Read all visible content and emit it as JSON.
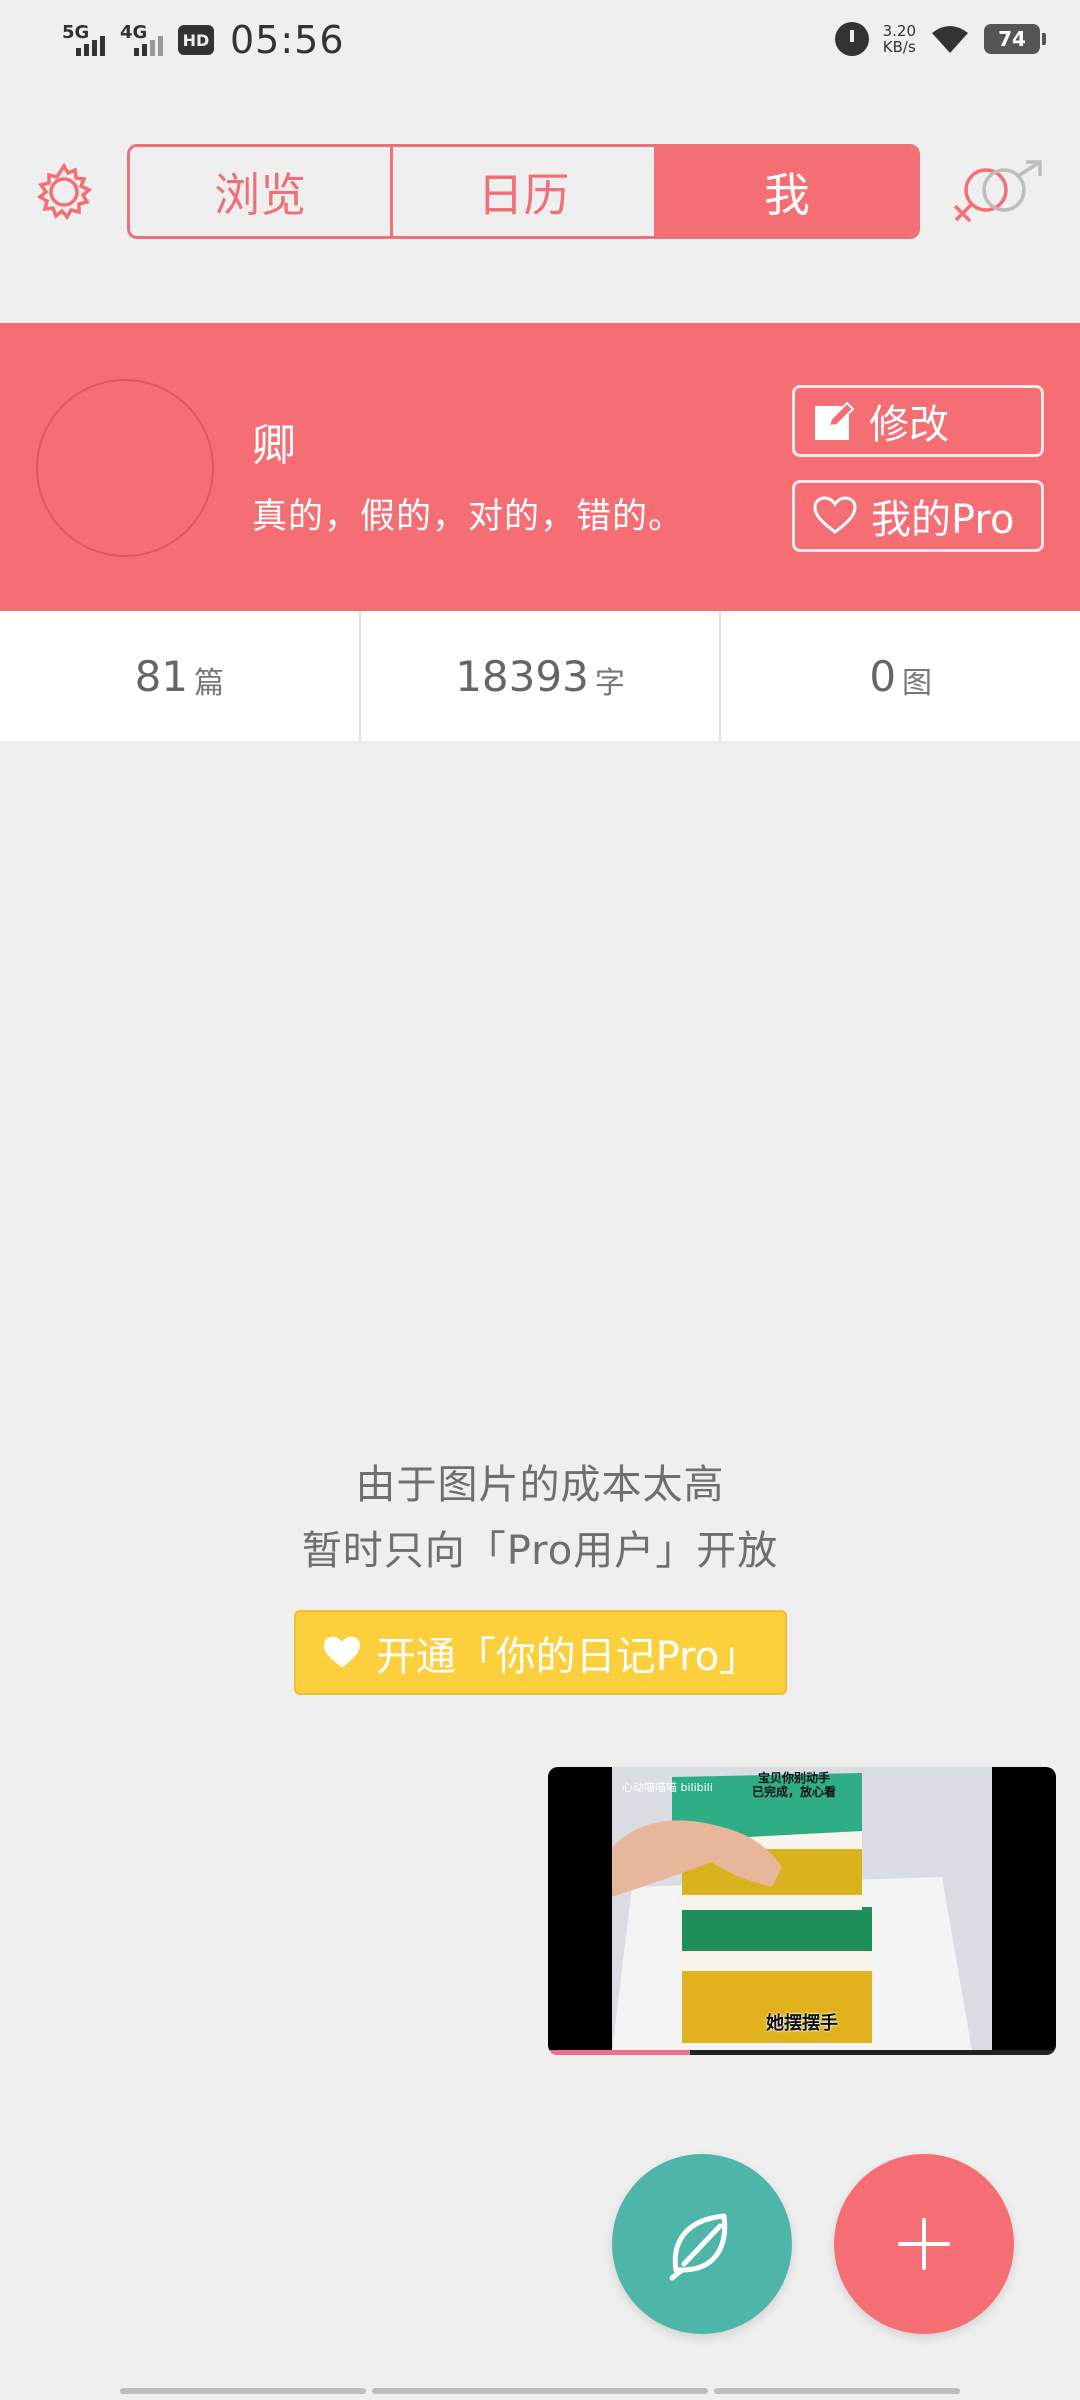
{
  "status_bar": {
    "network_1": "5G",
    "network_2": "4G",
    "hd_label": "HD",
    "time": "05:56",
    "speed_value": "3.20",
    "speed_unit": "KB/s",
    "battery": "74"
  },
  "nav": {
    "tabs": [
      {
        "label": "浏览",
        "active": false
      },
      {
        "label": "日历",
        "active": false
      },
      {
        "label": "我",
        "active": true
      }
    ]
  },
  "profile": {
    "name": "卿",
    "bio": "真的，假的，对的，错的。",
    "edit_label": "修改",
    "pro_label": "我的Pro"
  },
  "stats": [
    {
      "value": "81",
      "unit": "篇"
    },
    {
      "value": "18393",
      "unit": "字"
    },
    {
      "value": "0",
      "unit": "图"
    }
  ],
  "notice": {
    "line1": "由于图片的成本太高",
    "line2": "暂时只向「Pro用户」开放",
    "button_label": "开通「你的日记Pro」"
  },
  "video": {
    "caption": "她摆摆手",
    "top_caption_1": "宝贝你别动手",
    "top_caption_2": "已完成，放心看",
    "watermark": "心动喵喵喵 bilibili",
    "progress": 0.28
  },
  "colors": {
    "accent": "#f56e74",
    "fab_green": "#4db6a8",
    "pro_yellow": "#fcd03c"
  },
  "icons": {
    "settings": "gear-icon",
    "gender": "gender-icon",
    "edit": "edit-icon",
    "pro": "heart-icon",
    "leaf": "leaf-icon",
    "add": "plus-icon"
  }
}
